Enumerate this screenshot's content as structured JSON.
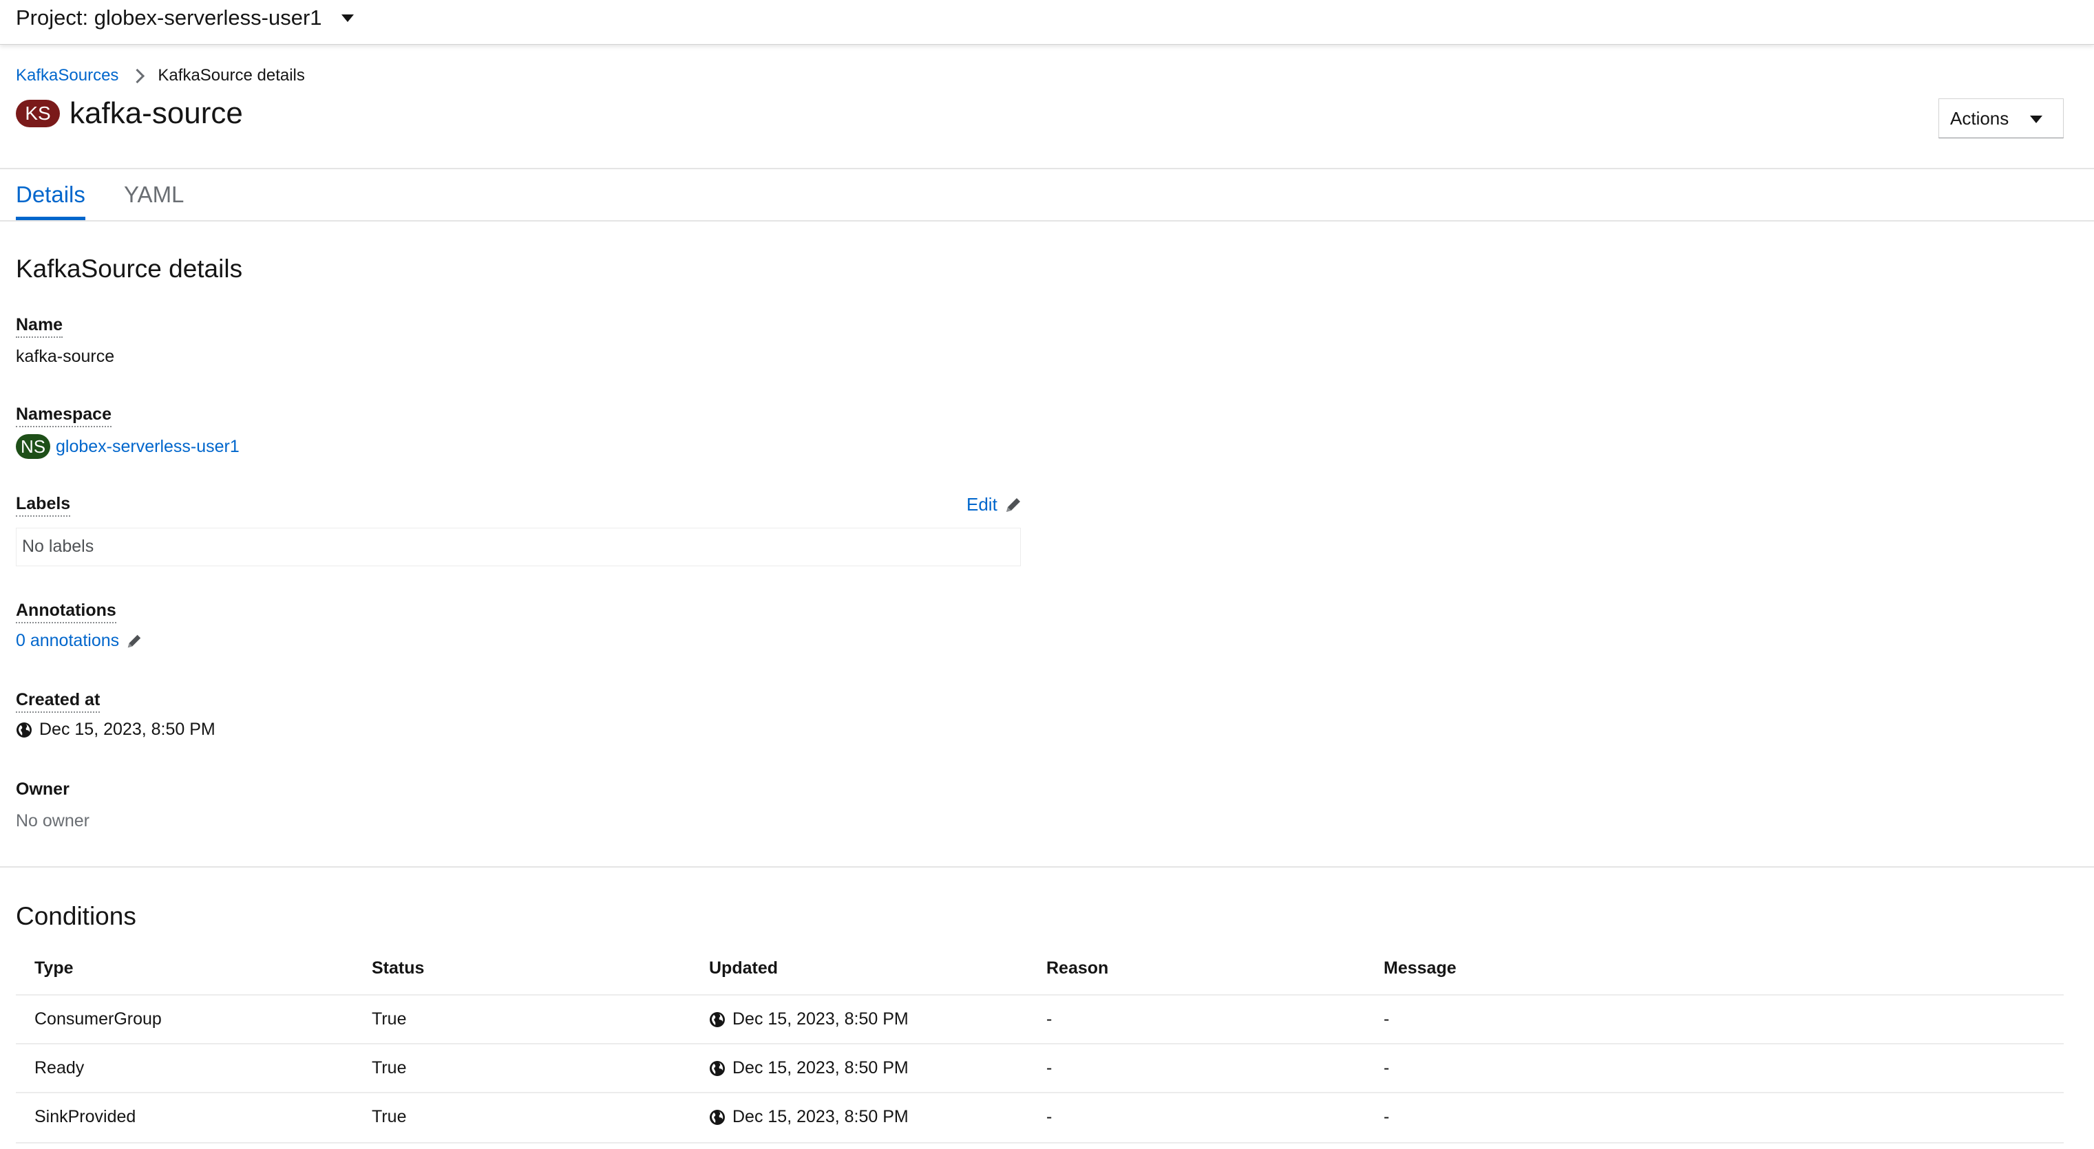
{
  "project_bar": {
    "label": "Project: globex-serverless-user1"
  },
  "breadcrumb": {
    "parent": "KafkaSources",
    "current": "KafkaSource details"
  },
  "header": {
    "badge": "KS",
    "title": "kafka-source",
    "actions_label": "Actions"
  },
  "tabs": [
    {
      "label": "Details",
      "active": true
    },
    {
      "label": "YAML",
      "active": false
    }
  ],
  "details": {
    "heading": "KafkaSource details",
    "name_label": "Name",
    "name_value": "kafka-source",
    "namespace_label": "Namespace",
    "namespace_badge": "NS",
    "namespace_value": "globex-serverless-user1",
    "labels_label": "Labels",
    "labels_edit": "Edit",
    "labels_value": "No labels",
    "annotations_label": "Annotations",
    "annotations_value": "0 annotations",
    "created_label": "Created at",
    "created_value": "Dec 15, 2023, 8:50 PM",
    "owner_label": "Owner",
    "owner_value": "No owner"
  },
  "conditions": {
    "heading": "Conditions",
    "columns": [
      "Type",
      "Status",
      "Updated",
      "Reason",
      "Message"
    ],
    "rows": [
      {
        "type": "ConsumerGroup",
        "status": "True",
        "updated": "Dec 15, 2023, 8:50 PM",
        "reason": "-",
        "message": "-"
      },
      {
        "type": "Ready",
        "status": "True",
        "updated": "Dec 15, 2023, 8:50 PM",
        "reason": "-",
        "message": "-"
      },
      {
        "type": "SinkProvided",
        "status": "True",
        "updated": "Dec 15, 2023, 8:50 PM",
        "reason": "-",
        "message": "-"
      }
    ]
  },
  "icons": {
    "dropdown": "caret-down-icon",
    "edit": "pencil-icon",
    "timestamp": "globe-icon",
    "breadcrumb": "chevron-right-icon"
  },
  "colors": {
    "link": "#0066cc",
    "ks_badge": "#7a1a1a",
    "ns_badge": "#1e4f18"
  }
}
